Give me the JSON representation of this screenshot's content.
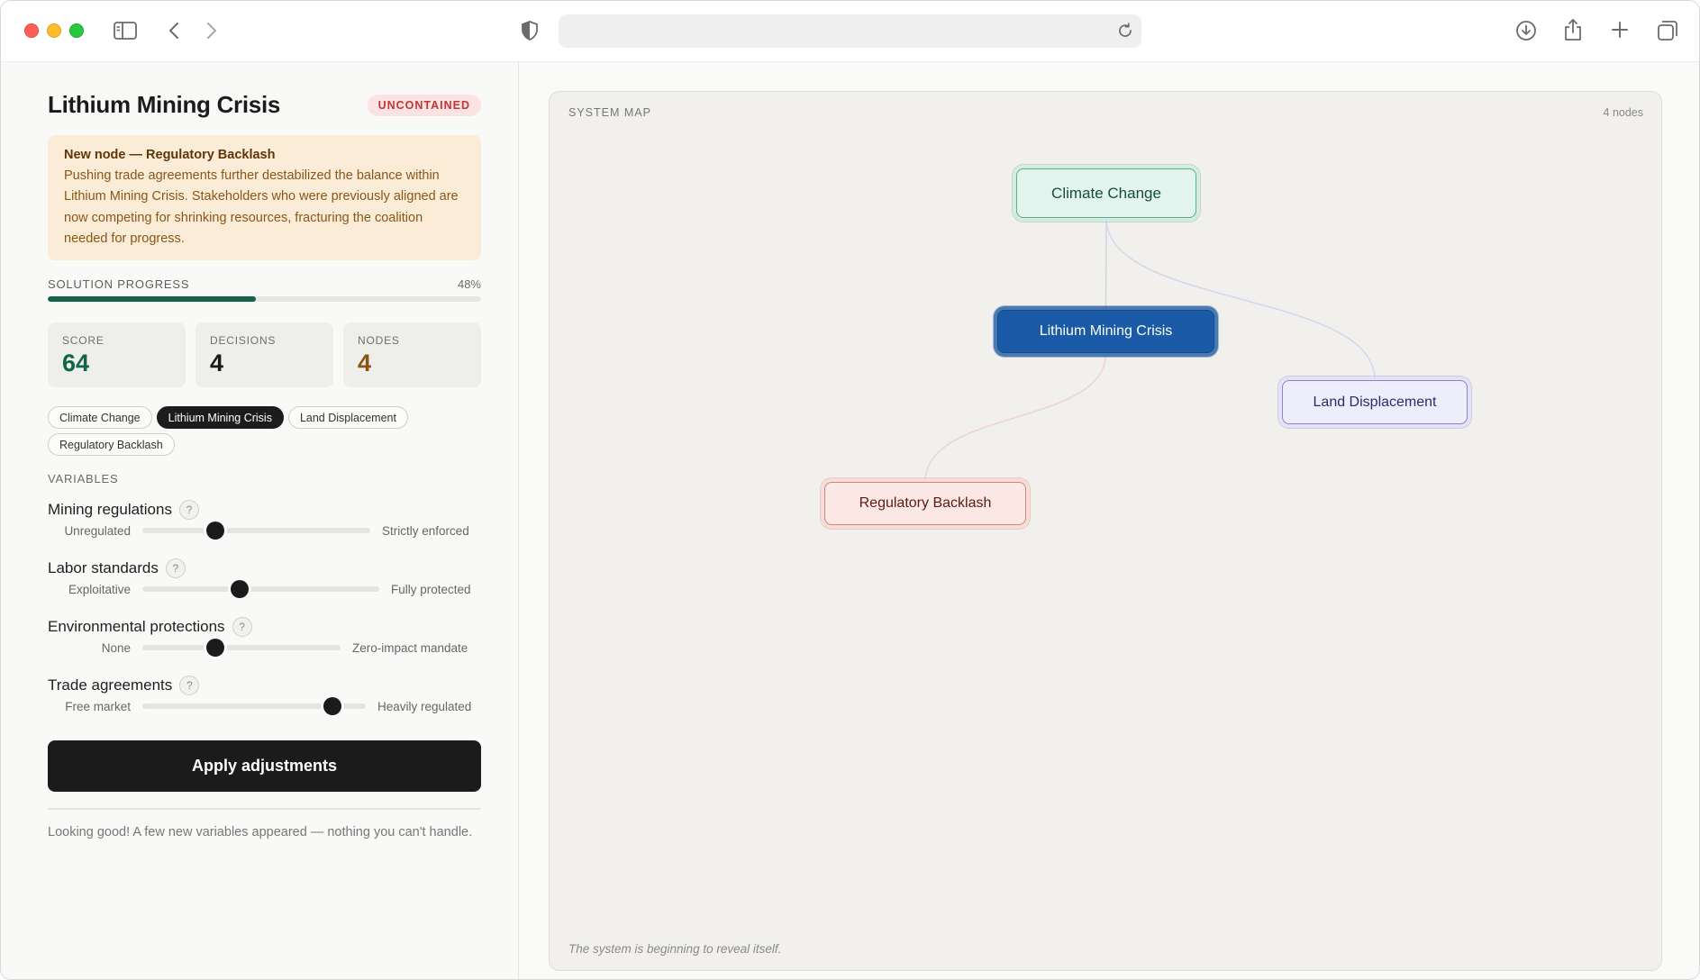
{
  "browser": {
    "url": "",
    "icons": [
      "sidebar-icon",
      "back-icon",
      "forward-icon",
      "shield-icon",
      "reload-icon",
      "download-icon",
      "share-icon",
      "new-tab-icon",
      "tabs-icon"
    ]
  },
  "sidebar": {
    "title": "Lithium Mining Crisis",
    "status_badge": "UNCONTAINED",
    "alert": {
      "title": "New node — Regulatory Backlash",
      "body": "Pushing trade agreements further destabilized the balance within Lithium Mining Crisis. Stakeholders who were previously aligned are now competing for shrinking resources, fracturing the coalition needed for progress."
    },
    "progress": {
      "label": "SOLUTION PROGRESS",
      "percent_text": "48%",
      "value": 0.48,
      "color": "#13624a"
    },
    "stats": [
      {
        "label": "SCORE",
        "value": "64",
        "color": "#13624a"
      },
      {
        "label": "DECISIONS",
        "value": "4",
        "color": "#1b1b1b"
      },
      {
        "label": "NODES",
        "value": "4",
        "color": "#8a5413"
      }
    ],
    "chips": [
      {
        "label": "Climate Change",
        "active": false
      },
      {
        "label": "Lithium Mining Crisis",
        "active": true
      },
      {
        "label": "Land Displacement",
        "active": false
      },
      {
        "label": "Regulatory Backlash",
        "active": false
      }
    ],
    "variables_heading": "VARIABLES",
    "variables": [
      {
        "name": "Mining regulations",
        "help": "?",
        "min_label": "Unregulated",
        "max_label": "Strictly enforced",
        "value": 0.32
      },
      {
        "name": "Labor standards",
        "help": "?",
        "min_label": "Exploitative",
        "max_label": "Fully protected",
        "value": 0.41
      },
      {
        "name": "Environmental protections",
        "help": "?",
        "min_label": "None",
        "max_label": "Zero-impact mandate",
        "value": 0.37
      },
      {
        "name": "Trade agreements",
        "help": "?",
        "min_label": "Free market",
        "max_label": "Heavily regulated",
        "value": 0.85
      }
    ],
    "apply_label": "Apply adjustments",
    "message": "Looking good! A few new variables appeared — nothing you can't handle."
  },
  "map": {
    "label": "SYSTEM MAP",
    "count": "4 nodes",
    "footer": "The system is beginning to reveal itself.",
    "nodes": [
      {
        "id": "climate",
        "label": "Climate Change",
        "bg": "#e3f4ee",
        "border": "#56b18f",
        "text": "#134e3c"
      },
      {
        "id": "lithium",
        "label": "Lithium Mining Crisis",
        "bg": "#1a5aa6",
        "border": "#144a8c",
        "text": "#ffffff"
      },
      {
        "id": "land",
        "label": "Land Displacement",
        "bg": "#eeedfc",
        "border": "#8a84d9",
        "text": "#2d2a6e"
      },
      {
        "id": "regulatory",
        "label": "Regulatory Backlash",
        "bg": "#fbe7e3",
        "border": "#d9837a",
        "text": "#5a1b15"
      }
    ],
    "edges": [
      {
        "from": "climate",
        "to": "lithium",
        "color": "#d4d4e0"
      },
      {
        "from": "climate",
        "to": "land",
        "color": "#d8d6ef"
      },
      {
        "from": "lithium",
        "to": "regulatory",
        "color": "#efd4d0"
      }
    ]
  }
}
